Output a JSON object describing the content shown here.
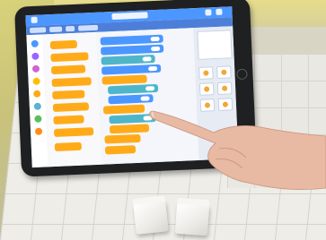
{
  "scene": {
    "description_kind": "photo",
    "colors": {
      "wall": "#d8d27a",
      "mat": "#eeede7",
      "tablet_bezel": "#1f2022",
      "app_topbar": "#4c97ff",
      "app_menubar": "#4d7fd9",
      "block_orange": "#ffab19",
      "block_blue": "#4c97ff",
      "block_teal": "#4fb6c9",
      "skin": "#e8b9a3"
    }
  },
  "tablet": {
    "icons": [
      "home-button"
    ]
  },
  "app": {
    "palette_block_count": 9,
    "workspace_block_count": 12
  }
}
